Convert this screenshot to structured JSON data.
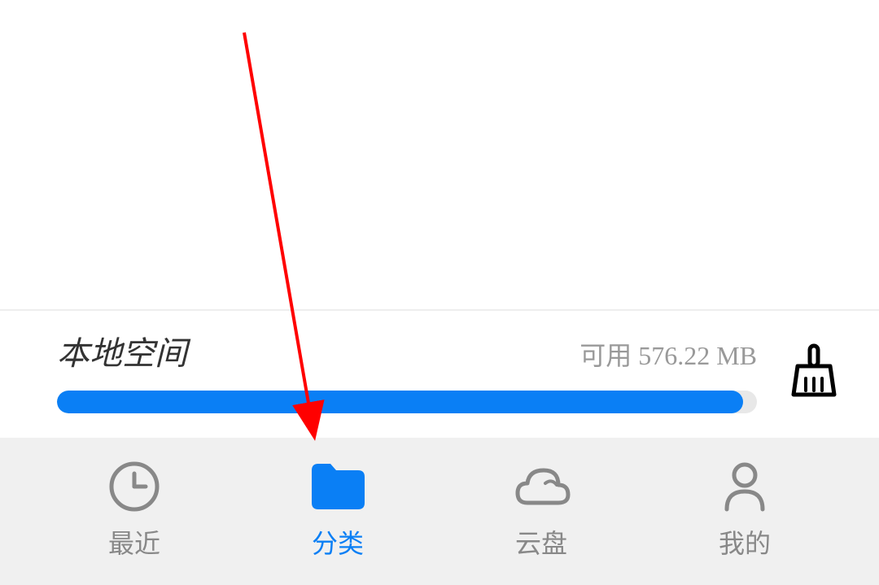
{
  "storage": {
    "title": "本地空间",
    "available_label": "可用 576.22 MB",
    "fill_percent": 98
  },
  "nav": {
    "items": [
      {
        "label": "最近",
        "active": false
      },
      {
        "label": "分类",
        "active": true
      },
      {
        "label": "云盘",
        "active": false
      },
      {
        "label": "我的",
        "active": false
      }
    ]
  },
  "colors": {
    "accent": "#0a7ff5",
    "text_muted": "#888888",
    "arrow": "#ff0000"
  }
}
